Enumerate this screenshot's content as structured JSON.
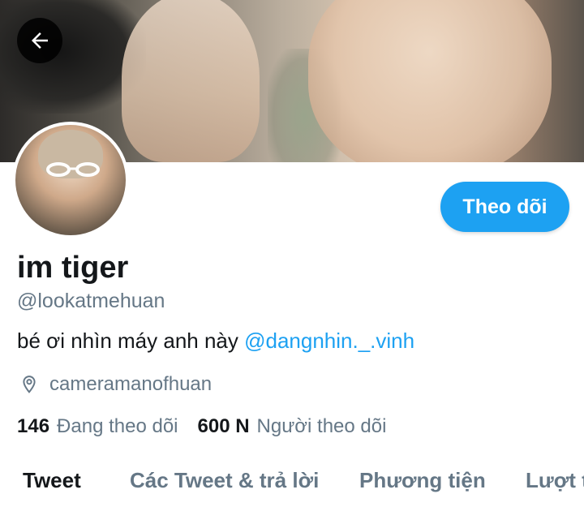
{
  "header": {
    "back_icon": "arrow-left-icon"
  },
  "profile": {
    "display_name": "im tiger",
    "handle": "@lookatmehuan",
    "bio_text": "bé ơi nhìn máy anh này ",
    "bio_mention": "@dangnhin._.vinh",
    "location": "cameramanofhuan",
    "location_icon": "location-pin-icon",
    "follow_label": "Theo dõi",
    "accent_color": "#1da1f2"
  },
  "stats": {
    "following_count": "146",
    "following_label": "Đang theo dõi",
    "followers_count": "600 N",
    "followers_label": "Người theo dõi"
  },
  "tabs": [
    {
      "label": "Tweet",
      "active": true
    },
    {
      "label": "Các Tweet & trả lời",
      "active": false
    },
    {
      "label": "Phương tiện",
      "active": false
    },
    {
      "label": "Lượt thích",
      "active": false
    }
  ]
}
